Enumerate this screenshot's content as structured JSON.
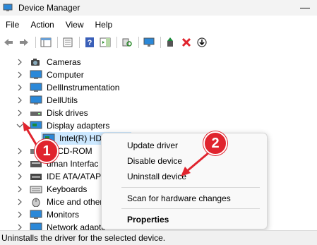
{
  "window": {
    "title": "Device Manager",
    "minimize_glyph": "—"
  },
  "menu": {
    "items": [
      "File",
      "Action",
      "View",
      "Help"
    ]
  },
  "toolbar": {
    "buttons": [
      "back-icon",
      "forward-icon",
      "show-hide-tree-icon",
      "properties-sheet-icon",
      "help-icon",
      "action-pane-icon",
      "scan-hardware-icon",
      "monitor-icon",
      "update-driver-icon",
      "uninstall-x-icon",
      "download-icon"
    ],
    "uninstall_color": "#e0242e",
    "update_color": "#1a8a3a"
  },
  "tree": {
    "items": [
      {
        "label": "Cameras",
        "icon": "camera-icon",
        "expanded": false
      },
      {
        "label": "Computer",
        "icon": "computer-icon",
        "expanded": false
      },
      {
        "label": "DellInstrumentation",
        "icon": "monitor-icon",
        "expanded": false
      },
      {
        "label": "DellUtils",
        "icon": "monitor-icon",
        "expanded": false
      },
      {
        "label": "Disk drives",
        "icon": "disk-drive-icon",
        "expanded": false
      },
      {
        "label": "Display adapters",
        "icon": "display-adapter-icon",
        "expanded": true
      },
      {
        "label": "Intel(R) HD G",
        "icon": "display-adapter-icon",
        "child": true,
        "selected": true
      },
      {
        "label": "/CD-ROM",
        "icon": "dvd-icon",
        "expanded": false
      },
      {
        "label": "uman Interfac",
        "icon": "hid-icon",
        "expanded": false
      },
      {
        "label": "IDE ATA/ATAPI c",
        "icon": "ide-icon",
        "expanded": false
      },
      {
        "label": "Keyboards",
        "icon": "keyboard-icon",
        "expanded": false
      },
      {
        "label": "Mice and other",
        "icon": "mouse-icon",
        "expanded": false
      },
      {
        "label": "Monitors",
        "icon": "monitor-icon",
        "expanded": false
      },
      {
        "label": "Network adapte",
        "icon": "network-icon",
        "expanded": false
      }
    ]
  },
  "context_menu": {
    "items": [
      {
        "label": "Update driver",
        "bold": false
      },
      {
        "label": "Disable device",
        "bold": false
      },
      {
        "label": "Uninstall device",
        "bold": false
      },
      {
        "label": "Scan for hardware changes",
        "bold": false
      },
      {
        "label": "Properties",
        "bold": true
      }
    ]
  },
  "annotations": {
    "badge1": "1",
    "badge2": "2",
    "color": "#e0242e"
  },
  "status": {
    "text": "Uninstalls the driver for the selected device."
  },
  "colors": {
    "selection": "#cce8ff",
    "monitor_blue": "#2b88d8"
  }
}
